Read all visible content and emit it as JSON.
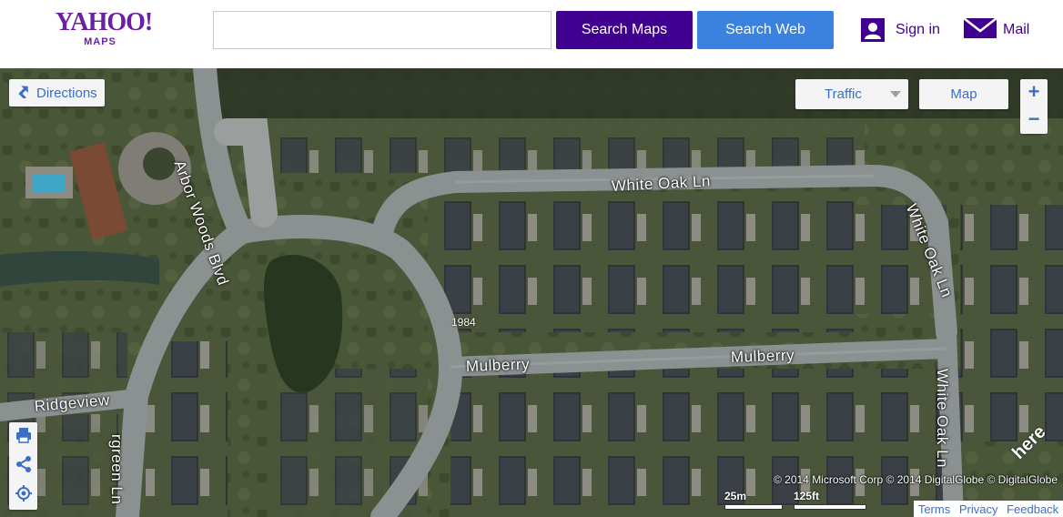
{
  "header": {
    "logo_main": "YAHOO!",
    "logo_sub": "MAPS",
    "search_value": "",
    "search_maps_label": "Search Maps",
    "search_web_label": "Search Web",
    "signin_label": "Sign in",
    "mail_label": "Mail"
  },
  "map": {
    "directions_label": "Directions",
    "traffic_label": "Traffic",
    "map_type_label": "Map",
    "zoom_in": "+",
    "zoom_out": "−",
    "streets": {
      "arbor": "Arbor Woods Blvd",
      "white_oak_top": "White Oak Ln",
      "white_oak_right": "White Oak Ln",
      "white_oak_far": "White Oak Ln",
      "mulberry_left": "Mulberry",
      "mulberry_right": "Mulberry",
      "ridgeview": "Ridgeview",
      "evergreen": "rgreen Ln"
    },
    "address_number": "1984",
    "copyright": "© 2014 Microsoft Corp © 2014 DigitalGlobe © DigitalGlobe",
    "here_logo": "here",
    "scale_metric": "25m",
    "scale_imperial": "125ft",
    "footer": {
      "terms": "Terms",
      "privacy": "Privacy",
      "feedback": "Feedback"
    }
  },
  "colors": {
    "brand_purple": "#400090",
    "web_blue": "#3a81e0",
    "link_blue": "#3a6fc8"
  },
  "icons": [
    "person-icon",
    "mail-icon",
    "directions-icon",
    "print-icon",
    "share-icon",
    "locate-icon"
  ]
}
